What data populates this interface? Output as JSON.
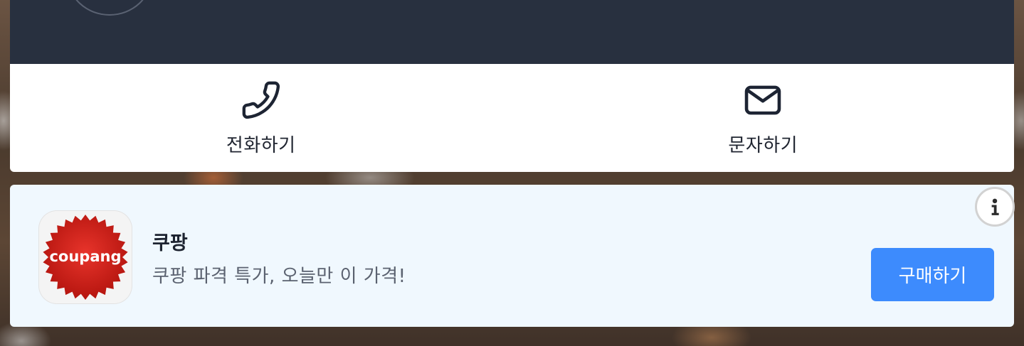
{
  "contact": {
    "call_label": "전화하기",
    "call_icon": "phone-icon",
    "sms_label": "문자하기",
    "sms_icon": "envelope-icon"
  },
  "ad": {
    "app_name": "쿠팡",
    "logo_text": "coupang",
    "description": "쿠팡 파격 특가, 오늘만 이 가격!",
    "cta_label": "구매하기",
    "info_icon": "info-icon",
    "colors": {
      "banner_bg": "#f0f8fe",
      "cta_bg": "#3d8bfd",
      "logo_red": "#d6231a",
      "header_bg": "#28303f"
    }
  }
}
